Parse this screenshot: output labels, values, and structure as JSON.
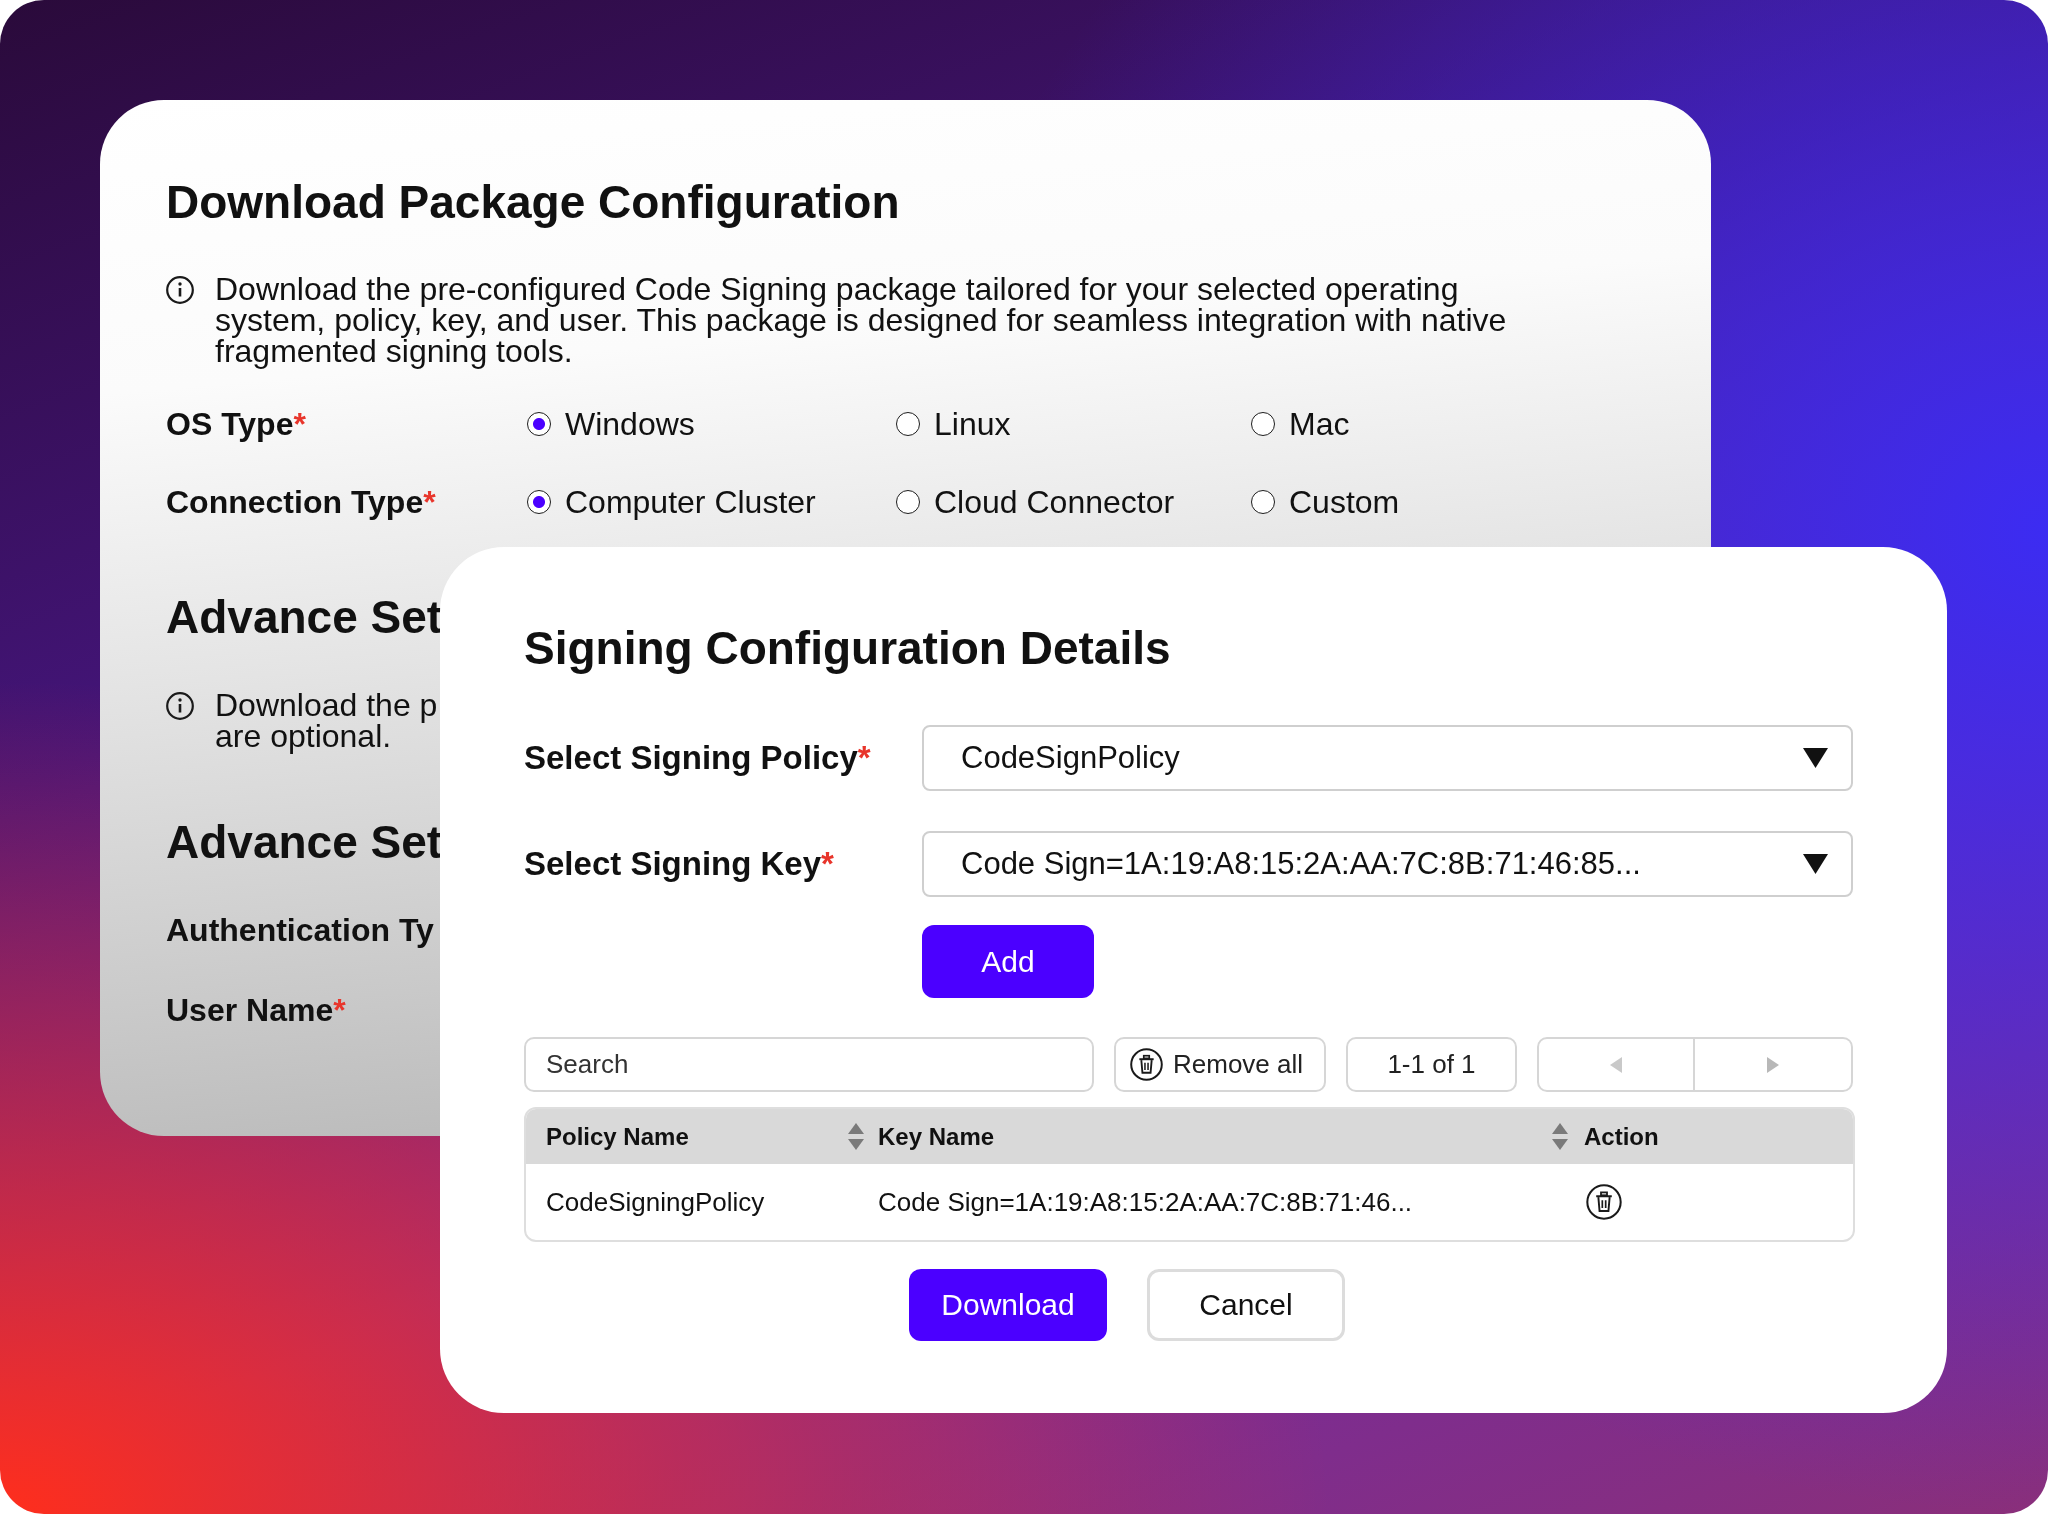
{
  "background_card": {
    "title": "Download Package Configuration",
    "info": "Download the pre-configured Code Signing package tailored for your selected operating system, policy, key, and user. This package is designed for seamless integration with native fragmented signing tools.",
    "radio_groups": [
      {
        "label": "OS Type",
        "required_mark": "*",
        "options": [
          {
            "label": "Windows",
            "selected": true
          },
          {
            "label": "Linux",
            "selected": false
          },
          {
            "label": "Mac",
            "selected": false
          }
        ]
      },
      {
        "label": "Connection Type",
        "required_mark": "*",
        "options": [
          {
            "label": "Computer Cluster",
            "selected": true
          },
          {
            "label": "Cloud Connector",
            "selected": false
          },
          {
            "label": "Custom",
            "selected": false
          }
        ]
      }
    ],
    "sections": [
      {
        "kind": "heading",
        "text": "Advance Set"
      },
      {
        "kind": "info",
        "text": "Download the p\nare optional."
      },
      {
        "kind": "heading",
        "text": "Advance Set"
      },
      {
        "kind": "field_label",
        "text": "Authentication Ty"
      },
      {
        "kind": "field_label",
        "text": "User Name",
        "required_mark": "*"
      }
    ]
  },
  "dialog": {
    "title": "Signing Configuration Details",
    "selects": [
      {
        "label": "Select Signing Policy",
        "required_mark": "*",
        "value": "CodeSignPolicy"
      },
      {
        "label": "Select Signing Key",
        "required_mark": "*",
        "value": "Code Sign=1A:19:A8:15:2A:AA:7C:8B:71:46:85..."
      }
    ],
    "add_button": "Add",
    "search": {
      "placeholder": "Search"
    },
    "remove_all_button": "Remove all",
    "pagination": {
      "range": "1-1 of 1"
    },
    "table": {
      "columns": [
        {
          "label": "Policy Name",
          "sortable": true
        },
        {
          "label": "Key Name",
          "sortable": true
        },
        {
          "label": "Action",
          "sortable": false
        }
      ],
      "rows": [
        {
          "policy_name": "CodeSigningPolicy",
          "key_name": "Code Sign=1A:19:A8:15:2A:AA:7C:8B:71:46..."
        }
      ]
    },
    "buttons": [
      {
        "label": "Download",
        "kind": "primary"
      },
      {
        "label": "Cancel",
        "kind": "secondary"
      }
    ]
  }
}
